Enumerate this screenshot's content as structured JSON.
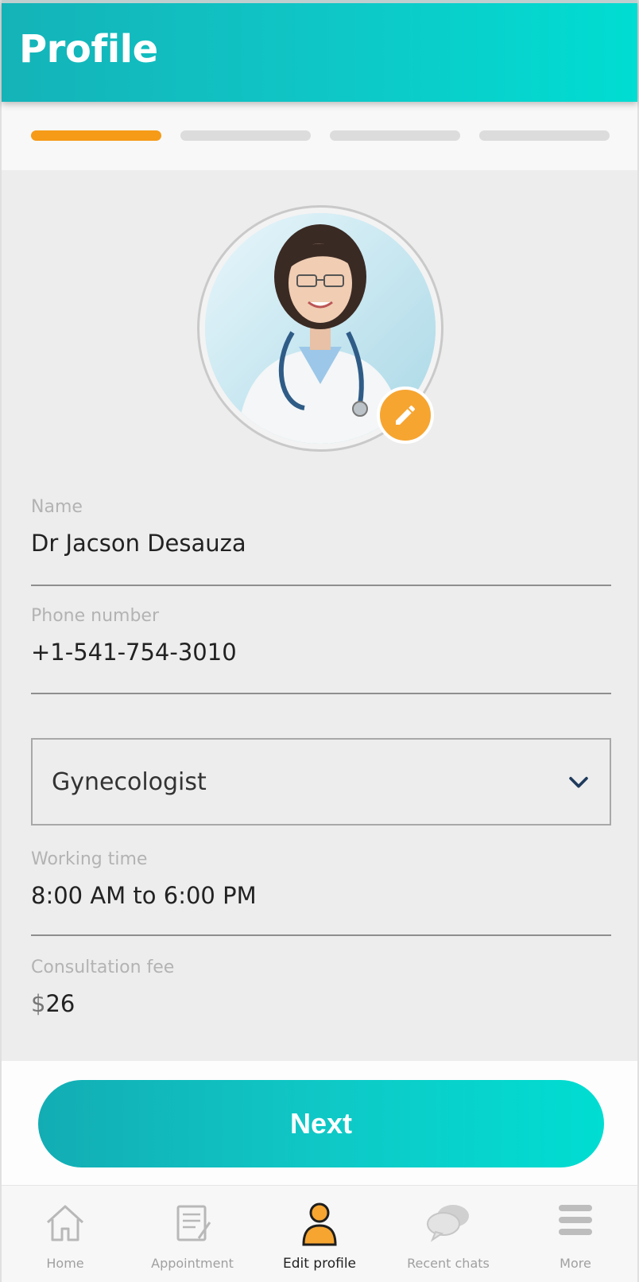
{
  "header": {
    "title": "Profile"
  },
  "stepper": {
    "total_steps": 4,
    "current_step": 1
  },
  "form": {
    "name_label": "Name",
    "name_value": "Dr Jacson Desauza",
    "phone_label": "Phone number",
    "phone_value": "+1-541-754-3010",
    "specialty_value": "Gynecologist",
    "working_time_label": "Working time",
    "working_time_value": "8:00 AM to 6:00 PM",
    "fee_label": "Consultation fee",
    "fee_currency": "$",
    "fee_amount": "26"
  },
  "actions": {
    "next_label": "Next"
  },
  "tabs": [
    {
      "label": "Home",
      "icon": "home-icon"
    },
    {
      "label": "Appointment",
      "icon": "appointment-icon"
    },
    {
      "label": "Edit profile",
      "icon": "edit-profile-icon",
      "active": true
    },
    {
      "label": "Recent chats",
      "icon": "chat-icon"
    },
    {
      "label": "More",
      "icon": "menu-icon"
    }
  ],
  "colors": {
    "header_gradient_start": "#14b3b8",
    "header_gradient_end": "#00ddd2",
    "active_step": "#f59b17",
    "edit_badge": "#f6a531",
    "active_tab_icon": "#f6a531"
  }
}
